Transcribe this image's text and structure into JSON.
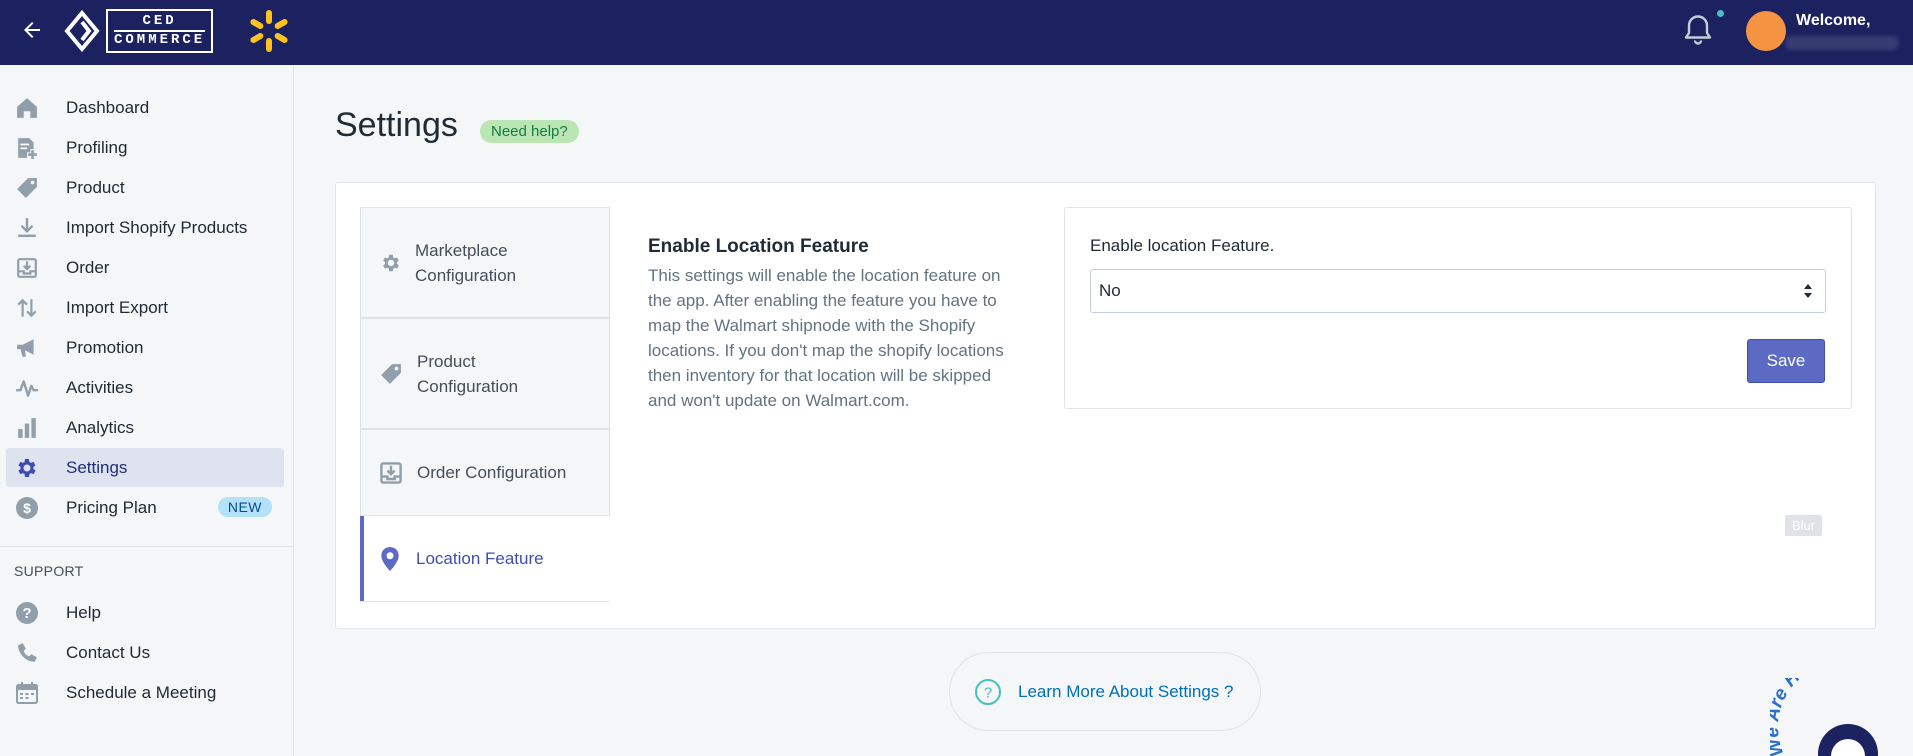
{
  "header": {
    "back_icon": "arrow-left-icon",
    "logo": {
      "line1": "CED",
      "line2": "COMMERCE"
    },
    "welcome": "Welcome,",
    "colors": {
      "bar": "#1c2260",
      "spark": "#ffc220",
      "avatar": "#f49342",
      "dot": "#47c1bf"
    }
  },
  "sidebar": {
    "items": [
      {
        "label": "Dashboard",
        "icon": "home-icon"
      },
      {
        "label": "Profiling",
        "icon": "profile-document-icon"
      },
      {
        "label": "Product",
        "icon": "tag-icon"
      },
      {
        "label": "Import Shopify Products",
        "icon": "import-icon"
      },
      {
        "label": "Order",
        "icon": "order-inbox-icon"
      },
      {
        "label": "Import Export",
        "icon": "arrows-up-down-icon"
      },
      {
        "label": "Promotion",
        "icon": "megaphone-icon"
      },
      {
        "label": "Activities",
        "icon": "activity-icon"
      },
      {
        "label": "Analytics",
        "icon": "bar-chart-icon"
      },
      {
        "label": "Settings",
        "icon": "gear-icon",
        "active": true
      },
      {
        "label": "Pricing Plan",
        "icon": "dollar-icon",
        "badge": "NEW"
      }
    ],
    "support_heading": "SUPPORT",
    "support_items": [
      {
        "label": "Help",
        "icon": "question-icon"
      },
      {
        "label": "Contact Us",
        "icon": "phone-icon"
      },
      {
        "label": "Schedule a Meeting",
        "icon": "calendar-icon"
      }
    ]
  },
  "main": {
    "title": "Settings",
    "help_badge": "Need help?",
    "tabs": [
      {
        "label": "Marketplace Configuration",
        "icon": "gear-icon"
      },
      {
        "label": "Product Configuration",
        "icon": "tag-icon"
      },
      {
        "label": "Order Configuration",
        "icon": "order-inbox-icon"
      },
      {
        "label": "Location Feature",
        "icon": "location-pin-icon",
        "active": true
      }
    ],
    "section": {
      "title": "Enable Location Feature",
      "description": "This settings will enable the location feature on the app. After enabling the feature you have to map the Walmart shipnode with the Shopify locations. If you don't map the shopify locations then inventory for that location will be skipped and won't update on Walmart.com."
    },
    "form": {
      "label": "Enable location Feature.",
      "select_value": "No",
      "save_label": "Save"
    },
    "blur_tag": "Blur",
    "learn_more": "Learn More About Settings ?",
    "chat_text": "We Are Here!",
    "colors": {
      "accent": "#5c6ac4",
      "badge_green": "#bbe5b3",
      "link": "#006fbb"
    }
  }
}
